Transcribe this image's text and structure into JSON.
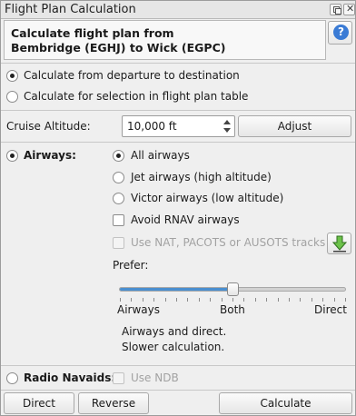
{
  "window": {
    "title": "Flight Plan Calculation"
  },
  "header": {
    "line1": "Calculate flight plan from",
    "line2": "Bembridge (EGHJ) to Wick (EGPC)"
  },
  "icons": {
    "help": "help-icon",
    "tracks": "download-tracks-icon",
    "float": "float-window-icon",
    "close": "close-icon"
  },
  "scope": {
    "departure_destination": {
      "label": "Calculate from departure to destination",
      "checked": true
    },
    "selection": {
      "label": "Calculate for selection in flight plan table",
      "checked": false
    }
  },
  "cruise": {
    "label": "Cruise Altitude:",
    "value": "10,000 ft",
    "adjust_label": "Adjust"
  },
  "airways": {
    "label": "Airways:",
    "checked": true,
    "options": [
      {
        "label": "All airways",
        "checked": true
      },
      {
        "label": "Jet airways (high altitude)",
        "checked": false
      },
      {
        "label": "Victor airways (low altitude)",
        "checked": false
      }
    ],
    "avoid_rnav": {
      "label": "Avoid RNAV airways",
      "checked": false
    },
    "use_tracks": {
      "label": "Use NAT, PACOTS or AUSOTS tracks",
      "checked": false,
      "enabled": false
    }
  },
  "prefer": {
    "label": "Prefer:",
    "value_fraction": 0.5,
    "labels": {
      "left": "Airways",
      "center": "Both",
      "right": "Direct"
    },
    "description_line1": "Airways and direct.",
    "description_line2": "Slower calculation."
  },
  "radio_navaids": {
    "label": "Radio Navaids:",
    "checked": false,
    "use_ndb": {
      "label": "Use NDB",
      "checked": false,
      "enabled": false
    }
  },
  "buttons": {
    "direct": "Direct",
    "reverse": "Reverse",
    "calculate": "Calculate"
  },
  "colors": {
    "slider_fill": "#4a8fd0",
    "help_icon": "#3a7bd5",
    "tracks_arrow": "#6cc24a"
  }
}
